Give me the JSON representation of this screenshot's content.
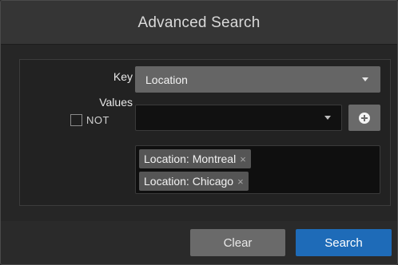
{
  "dialog": {
    "title": "Advanced Search"
  },
  "form": {
    "key_label": "Key",
    "key_value": "Location",
    "values_label": "Values",
    "not_label": "NOT",
    "not_checked": false,
    "values_input_value": "",
    "add_icon": "plus-circle-icon",
    "tags": [
      {
        "label": "Location: Montreal",
        "remove_icon": "×"
      },
      {
        "label": "Location: Chicago",
        "remove_icon": "×"
      }
    ]
  },
  "footer": {
    "clear_label": "Clear",
    "search_label": "Search"
  },
  "colors": {
    "primary_button": "#1e6bb8",
    "secondary_button": "#6a6a6a",
    "background": "#2a2a2a"
  }
}
